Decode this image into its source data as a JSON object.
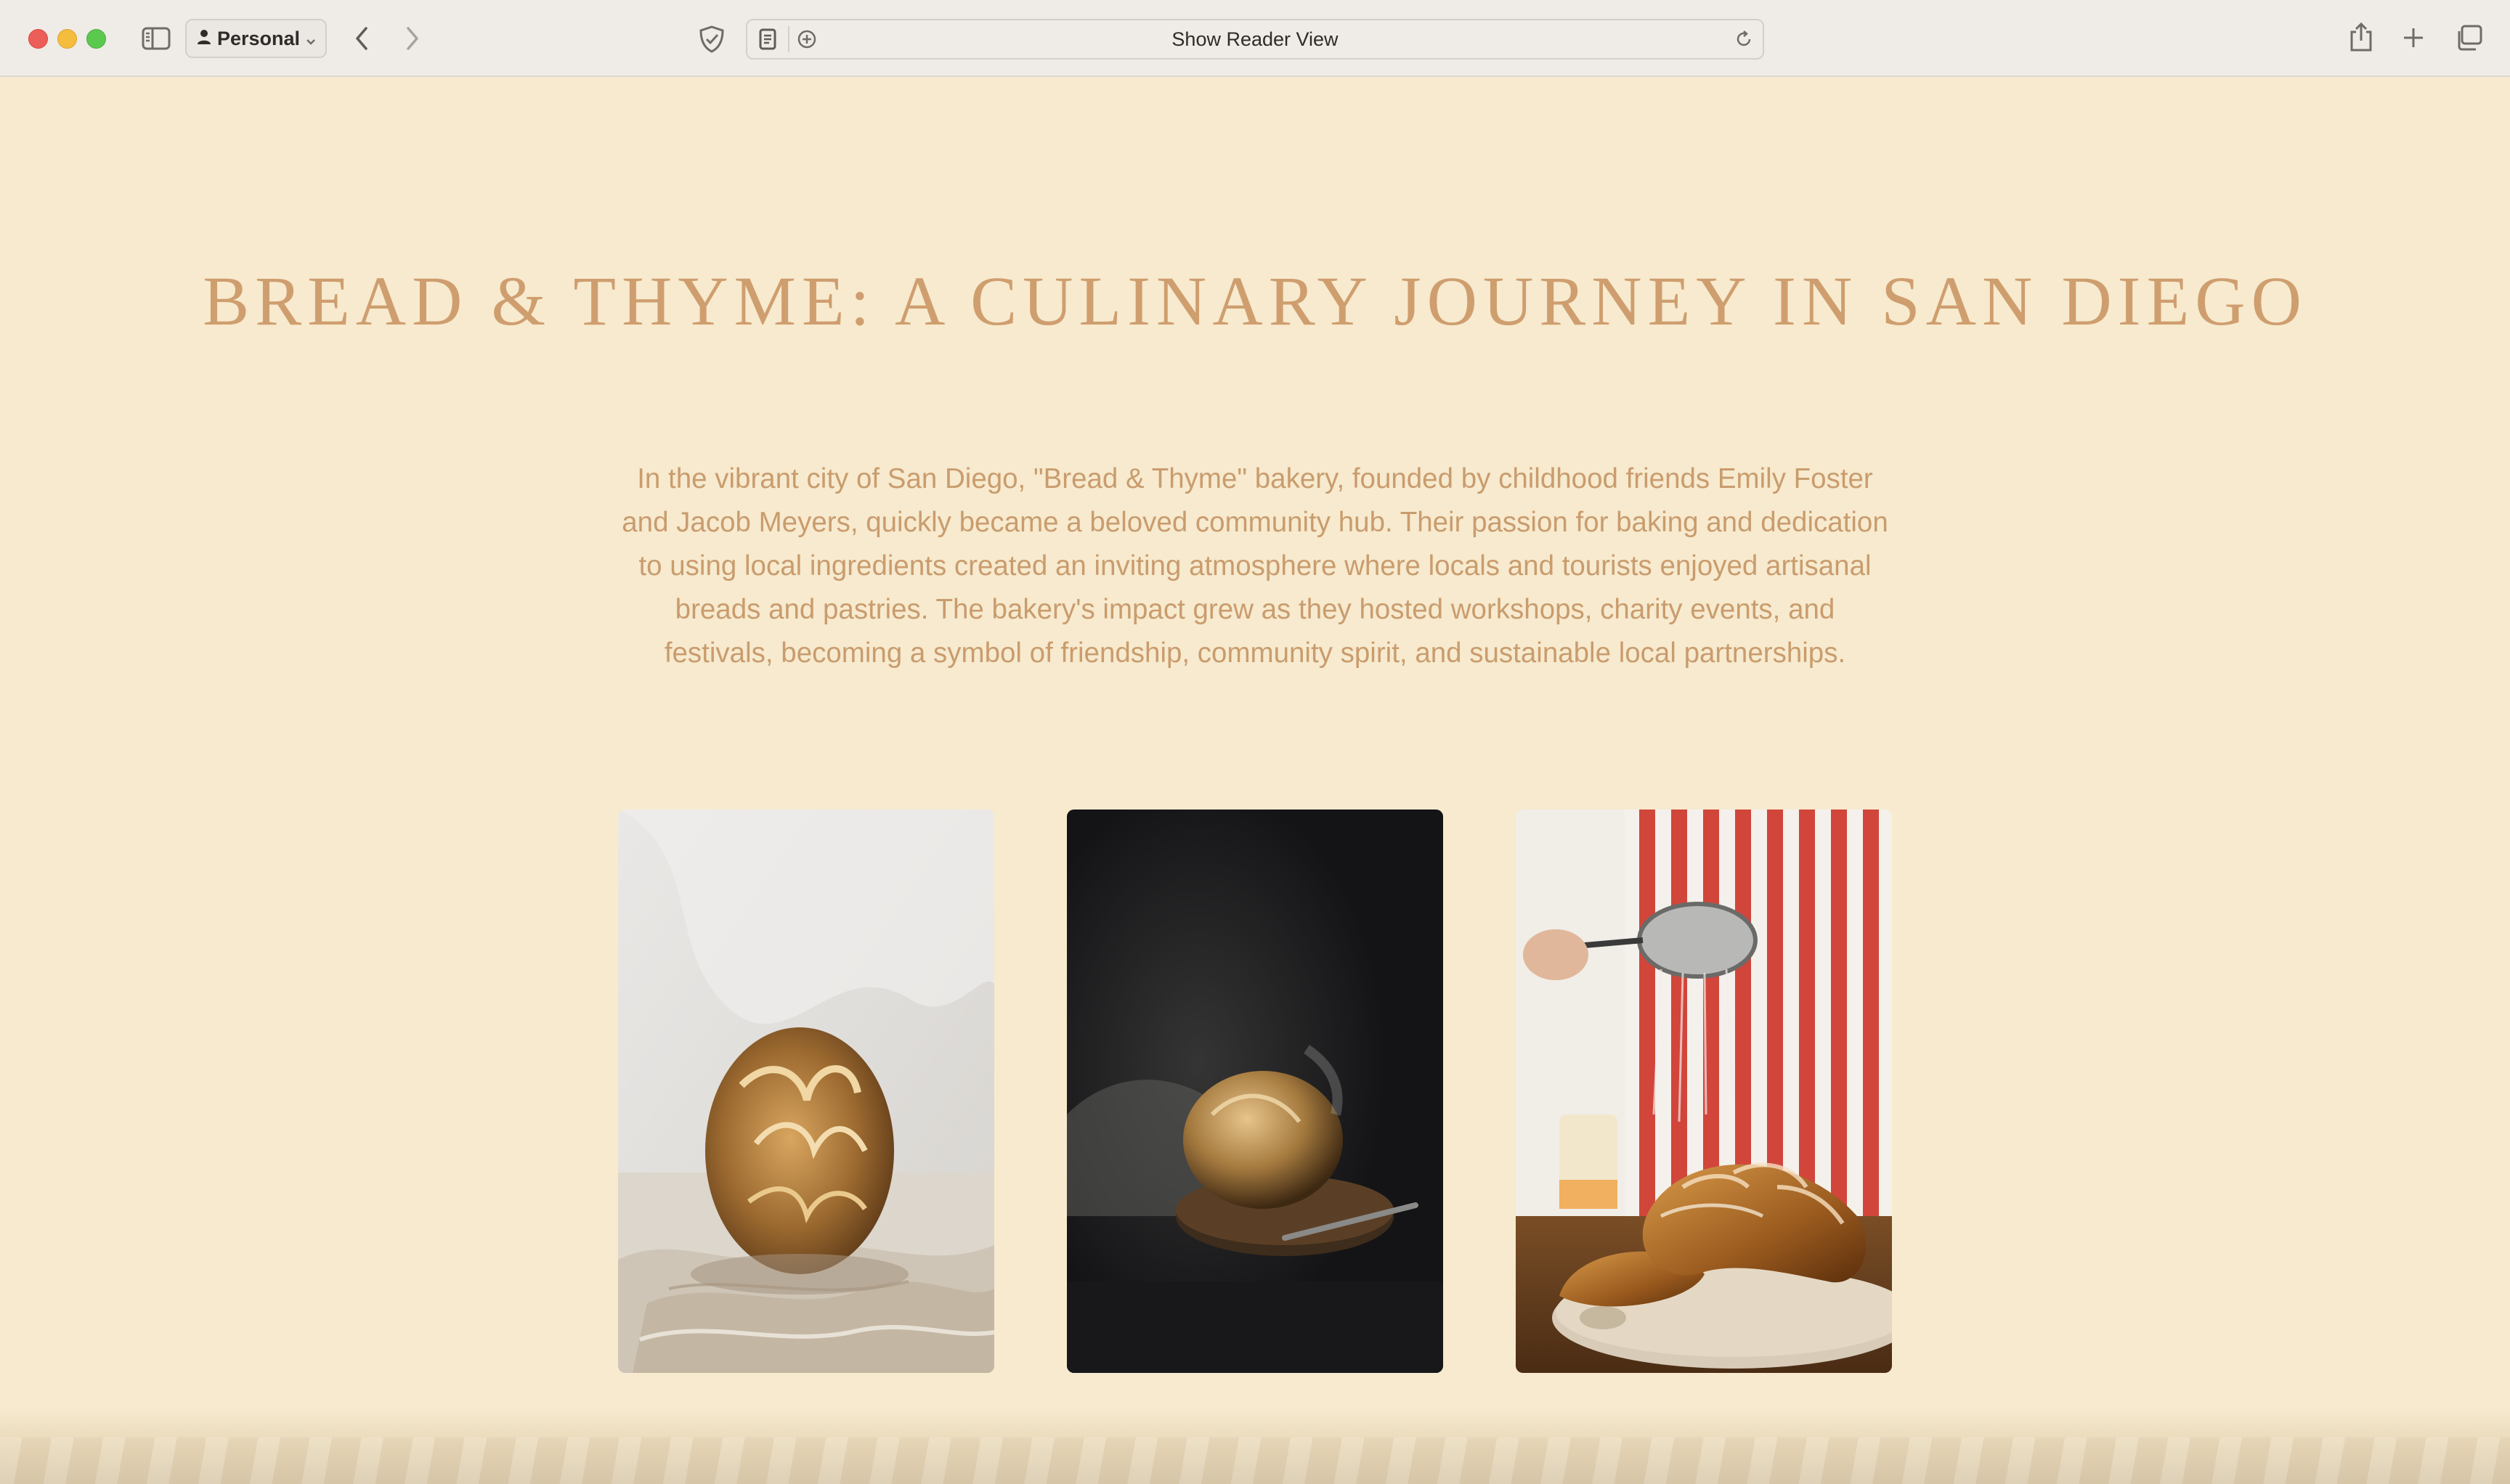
{
  "browser": {
    "profile_label": "Personal",
    "address_text": "Show Reader View"
  },
  "icons": {
    "sidebar": "sidebar-icon",
    "profile": "person-icon",
    "back": "chevron-left-icon",
    "forward": "chevron-right-icon",
    "privacy": "shield-icon",
    "reader": "reader-icon",
    "extensions": "plus-circle-icon",
    "reload": "reload-icon",
    "share": "share-icon",
    "new_tab": "plus-icon",
    "tabs": "tabs-overview-icon"
  },
  "page": {
    "title": "BREAD & THYME: A CULINARY JOURNEY IN SAN DIEGO",
    "intro": "In the vibrant city of San Diego, \"Bread & Thyme\" bakery, founded by childhood friends Emily Foster and Jacob Meyers, quickly became a beloved community hub. Their passion for baking and dedication to using local ingredients created an inviting atmosphere where locals and tourists enjoyed artisanal breads and pastries. The bakery's impact grew as they hosted workshops, charity events, and festivals, becoming a symbol of friendship, community spirit, and sustainable local partnerships."
  },
  "colors": {
    "page_background": "#f7eace",
    "title": "#cf9e6f",
    "body_text": "#c99c6e"
  }
}
